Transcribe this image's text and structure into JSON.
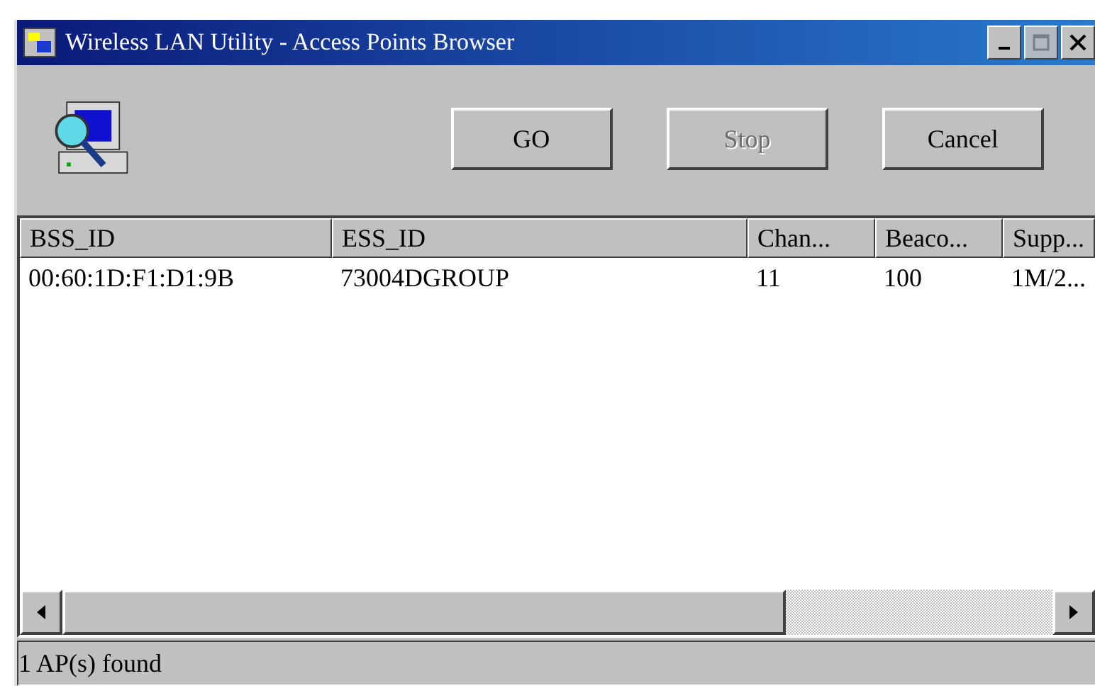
{
  "window": {
    "title": "Wireless LAN Utility - Access Points Browser"
  },
  "title_buttons": [
    {
      "kind": "minimize",
      "disabled": false
    },
    {
      "kind": "maximize",
      "disabled": true
    },
    {
      "kind": "close",
      "disabled": false
    }
  ],
  "toolbar": {
    "buttons": [
      {
        "label": "GO",
        "disabled": false
      },
      {
        "label": "Stop",
        "disabled": true
      },
      {
        "label": "Cancel",
        "disabled": false
      }
    ]
  },
  "table": {
    "columns": [
      "BSS_ID",
      "ESS_ID",
      "Chan...",
      "Beaco...",
      "Supp..."
    ],
    "rows": [
      {
        "cells": [
          "00:60:1D:F1:D1:9B",
          "73004DGROUP",
          "11",
          "100",
          "1M/2..."
        ],
        "selected": false
      }
    ]
  },
  "status_bar": "1 AP(s) found"
}
